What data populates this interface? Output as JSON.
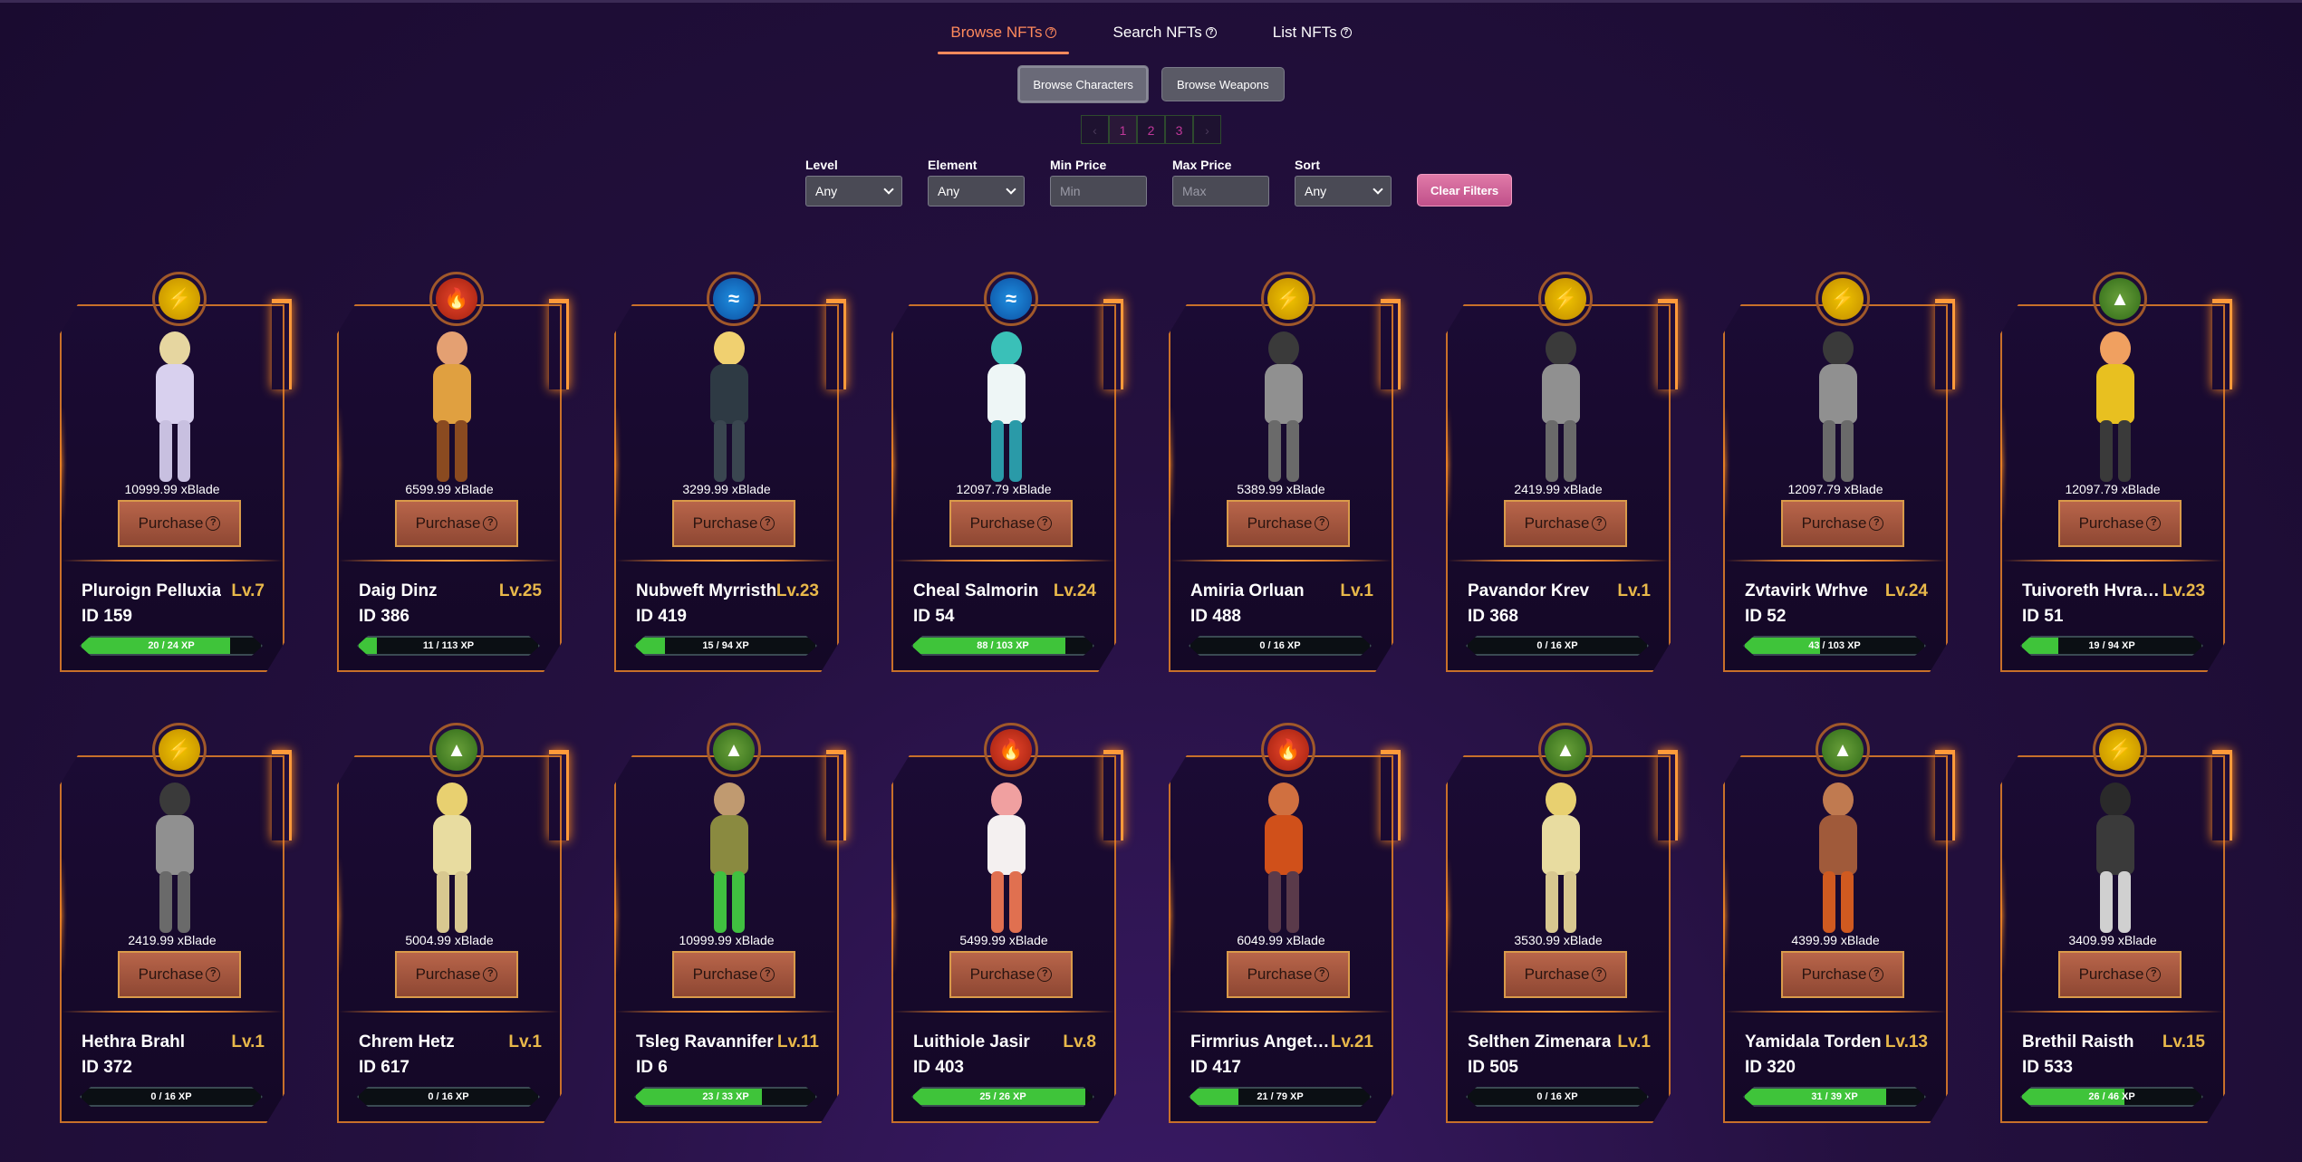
{
  "tabs": [
    {
      "label": "Browse NFTs",
      "active": true
    },
    {
      "label": "Search NFTs",
      "active": false
    },
    {
      "label": "List NFTs",
      "active": false
    }
  ],
  "subtabs": [
    {
      "label": "Browse Characters",
      "active": true
    },
    {
      "label": "Browse Weapons",
      "active": false
    }
  ],
  "pagination": {
    "prev": "‹",
    "pages": [
      "1",
      "2",
      "3"
    ],
    "next": "›",
    "current": "1"
  },
  "filters": {
    "level": {
      "label": "Level",
      "value": "Any"
    },
    "element": {
      "label": "Element",
      "value": "Any"
    },
    "min_price": {
      "label": "Min Price",
      "placeholder": "Min"
    },
    "max_price": {
      "label": "Max Price",
      "placeholder": "Max"
    },
    "sort": {
      "label": "Sort",
      "value": "Any"
    },
    "clear_label": "Clear Filters"
  },
  "purchase_label": "Purchase",
  "colors": {
    "accent": "#ff8a5c",
    "frame": "#c8702a",
    "xp_fill": "#3fc43a",
    "level": "#e8b84a"
  },
  "characters": [
    {
      "name": "Pluroign Pelluxia",
      "level": "Lv.7",
      "id": "ID 159",
      "price": "10999.99 xBlade",
      "xp": "20 / 24 XP",
      "xp_fraction": 0.83,
      "element": "lightning",
      "palette": [
        "#e6d6a0",
        "#d8d0ee",
        "#c8c0e0"
      ]
    },
    {
      "name": "Daig Dinz",
      "level": "Lv.25",
      "id": "ID 386",
      "price": "6599.99 xBlade",
      "xp": "11 / 113 XP",
      "xp_fraction": 0.1,
      "element": "fire",
      "palette": [
        "#e4a072",
        "#e0a040",
        "#8a4a20"
      ]
    },
    {
      "name": "Nubweft Myrristh",
      "level": "Lv.23",
      "id": "ID 419",
      "price": "3299.99 xBlade",
      "xp": "15 / 94 XP",
      "xp_fraction": 0.16,
      "element": "water",
      "palette": [
        "#f0d070",
        "#2e3a44",
        "#3a4650"
      ]
    },
    {
      "name": "Cheal Salmorin",
      "level": "Lv.24",
      "id": "ID 54",
      "price": "12097.79 xBlade",
      "xp": "88 / 103 XP",
      "xp_fraction": 0.85,
      "element": "water",
      "palette": [
        "#3ac0b8",
        "#eef6f6",
        "#2a9aa8"
      ]
    },
    {
      "name": "Amiria Orluan",
      "level": "Lv.1",
      "id": "ID 488",
      "price": "5389.99 xBlade",
      "xp": "0 / 16 XP",
      "xp_fraction": 0,
      "element": "lightning",
      "palette": [
        "#3a3a3a",
        "#909090",
        "#6a6a6a"
      ]
    },
    {
      "name": "Pavandor Krev",
      "level": "Lv.1",
      "id": "ID 368",
      "price": "2419.99 xBlade",
      "xp": "0 / 16 XP",
      "xp_fraction": 0,
      "element": "lightning",
      "palette": [
        "#3a3a3a",
        "#909090",
        "#6a6a6a"
      ]
    },
    {
      "name": "Zvtavirk Wrhve",
      "level": "Lv.24",
      "id": "ID 52",
      "price": "12097.79 xBlade",
      "xp": "43 / 103 XP",
      "xp_fraction": 0.42,
      "element": "lightning",
      "palette": [
        "#3a3a3a",
        "#909090",
        "#6a6a6a"
      ]
    },
    {
      "name": "Tuivoreth Hvrasmir",
      "level": "Lv.23",
      "id": "ID 51",
      "price": "12097.79 xBlade",
      "xp": "19 / 94 XP",
      "xp_fraction": 0.2,
      "element": "earth",
      "palette": [
        "#f0a060",
        "#e8c020",
        "#3a3a3a"
      ]
    },
    {
      "name": "Hethra Brahl",
      "level": "Lv.1",
      "id": "ID 372",
      "price": "2419.99 xBlade",
      "xp": "0 / 16 XP",
      "xp_fraction": 0,
      "element": "lightning",
      "palette": [
        "#3a3a3a",
        "#909090",
        "#6a6a6a"
      ]
    },
    {
      "name": "Chrem Hetz",
      "level": "Lv.1",
      "id": "ID 617",
      "price": "5004.99 xBlade",
      "xp": "0 / 16 XP",
      "xp_fraction": 0,
      "element": "earth",
      "palette": [
        "#e8d070",
        "#e8dca0",
        "#d8c890"
      ]
    },
    {
      "name": "Tsleg Ravannifer",
      "level": "Lv.11",
      "id": "ID 6",
      "price": "10999.99 xBlade",
      "xp": "23 / 33 XP",
      "xp_fraction": 0.7,
      "element": "earth",
      "palette": [
        "#c09a70",
        "#8a8a40",
        "#40c040"
      ]
    },
    {
      "name": "Luithiole Jasir",
      "level": "Lv.8",
      "id": "ID 403",
      "price": "5499.99 xBlade",
      "xp": "25 / 26 XP",
      "xp_fraction": 0.96,
      "element": "fire",
      "palette": [
        "#f0a0a0",
        "#f4f0f0",
        "#e07050"
      ]
    },
    {
      "name": "Firmrius Angeteron",
      "level": "Lv.21",
      "id": "ID 417",
      "price": "6049.99 xBlade",
      "xp": "21 / 79 XP",
      "xp_fraction": 0.27,
      "element": "fire",
      "palette": [
        "#d07040",
        "#d0501a",
        "#5a3a4a"
      ]
    },
    {
      "name": "Selthen Zimenara",
      "level": "Lv.1",
      "id": "ID 505",
      "price": "3530.99 xBlade",
      "xp": "0 / 16 XP",
      "xp_fraction": 0,
      "element": "earth",
      "palette": [
        "#e8d070",
        "#e8dca0",
        "#d8c890"
      ]
    },
    {
      "name": "Yamidala Torden",
      "level": "Lv.13",
      "id": "ID 320",
      "price": "4399.99 xBlade",
      "xp": "31 / 39 XP",
      "xp_fraction": 0.79,
      "element": "earth",
      "palette": [
        "#c07a50",
        "#a05a3a",
        "#d05a20"
      ]
    },
    {
      "name": "Brethil Raisth",
      "level": "Lv.15",
      "id": "ID 533",
      "price": "3409.99 xBlade",
      "xp": "26 / 46 XP",
      "xp_fraction": 0.57,
      "element": "lightning",
      "palette": [
        "#2a2a2a",
        "#3a3a3a",
        "#d0d0d0"
      ]
    }
  ]
}
